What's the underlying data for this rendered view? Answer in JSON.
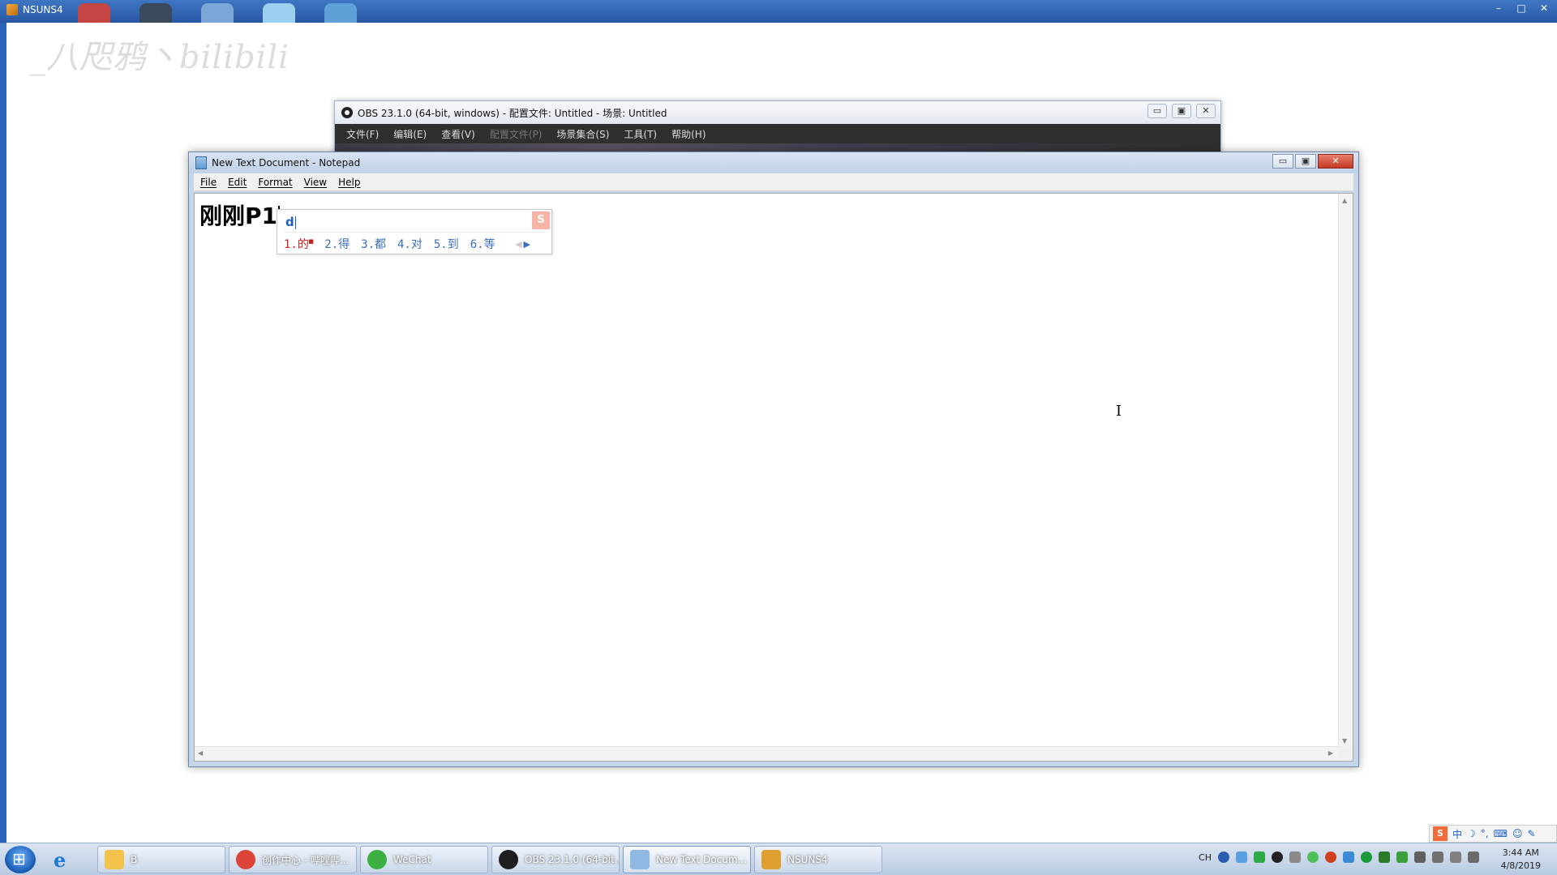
{
  "host": {
    "title": "NSUNS4",
    "watermark": "_八咫鸦丶bilibili",
    "controls": [
      "–",
      "□",
      "✕"
    ]
  },
  "obs": {
    "title": "OBS 23.1.0 (64-bit, windows) - 配置文件: Untitled - 场景: Untitled",
    "menu": [
      "文件(F)",
      "编辑(E)",
      "查看(V)",
      "配置文件(P)",
      "场景集合(S)",
      "工具(T)",
      "帮助(H)"
    ],
    "controls": [
      "▭",
      "▣",
      "✕"
    ]
  },
  "notepad": {
    "title": "New Text Document - Notepad",
    "menu": [
      "File",
      "Edit",
      "Format",
      "View",
      "Help"
    ],
    "content": "刚刚P1",
    "controls": [
      "▭",
      "▣",
      "✕"
    ]
  },
  "ime": {
    "input": "d",
    "logo": "S",
    "candidates": [
      "1.的",
      "2.得",
      "3.都",
      "4.对",
      "5.到",
      "6.等"
    ],
    "selected_index": 0
  },
  "taskbar": {
    "items": [
      {
        "label": "B",
        "icon": "folder-icon",
        "color": "#f3c24a"
      },
      {
        "label": "创作中心 - 哔哩哔...",
        "icon": "chrome-icon",
        "color": "#db4437"
      },
      {
        "label": "WeChat",
        "icon": "wechat-icon",
        "color": "#3cb043"
      },
      {
        "label": "OBS 23.1.0 (64-bit...",
        "icon": "obs-icon",
        "color": "#1e1e1e"
      },
      {
        "label": "New Text Docum...",
        "icon": "notepad-icon",
        "color": "#8fb9e0"
      },
      {
        "label": "NSUNS4",
        "icon": "game-icon",
        "color": "#e0a030"
      }
    ],
    "tray_lang": "CH",
    "clock_time": "3:44 AM",
    "clock_date": "4/8/2019"
  },
  "ime_bar": {
    "mode": "中"
  }
}
